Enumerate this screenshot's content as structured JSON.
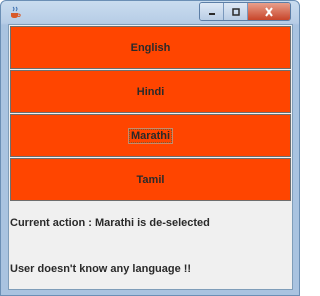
{
  "window": {
    "icon": "java-cup-icon",
    "controls": [
      "minimize-icon",
      "maximize-icon",
      "close-icon"
    ],
    "accent_color": "#ff4500"
  },
  "buttons": [
    {
      "label": "English"
    },
    {
      "label": "Hindi"
    },
    {
      "label": "Marathi",
      "focused": true
    },
    {
      "label": "Tamil"
    }
  ],
  "status": {
    "action": "Current action : Marathi is de-selected",
    "summary": "User doesn't know any language !!"
  }
}
